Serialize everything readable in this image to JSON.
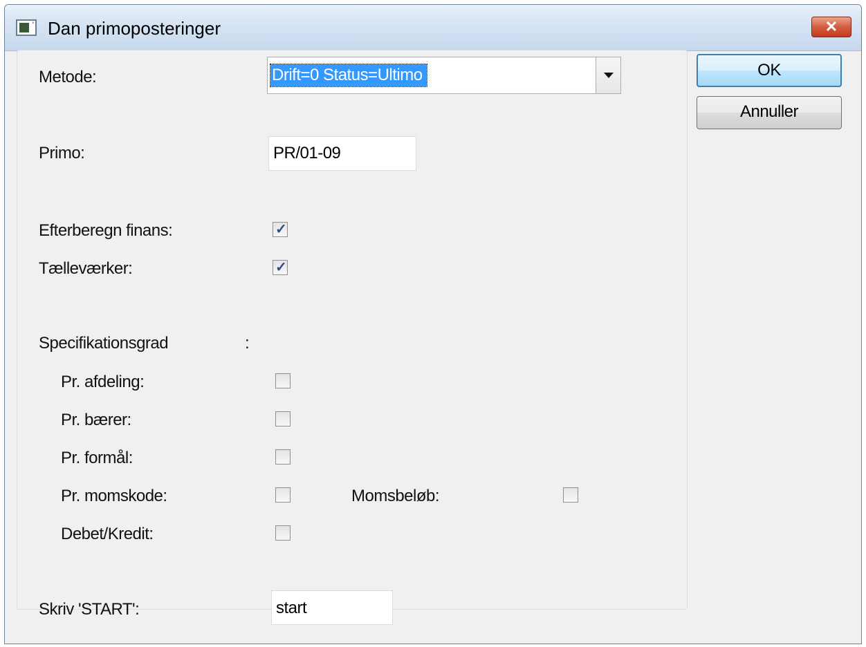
{
  "window": {
    "title": "Dan primoposteringer",
    "close_label": "✕"
  },
  "form": {
    "metode_label": "Metode:",
    "metode_value": "Drift=0 Status=Ultimo",
    "primo_label": "Primo:",
    "primo_value": "PR/01-09",
    "efterberegn_label": "Efterberegn finans:",
    "efterberegn_checked": true,
    "taellevaerker_label": "Tælleværker:",
    "taellevaerker_checked": true,
    "specifikationsgrad_label": "Specifikationsgrad",
    "specifikationsgrad_colon": ":",
    "afdeling_label": "Pr. afdeling:",
    "afdeling_checked": false,
    "baerer_label": "Pr. bærer:",
    "baerer_checked": false,
    "formaal_label": "Pr. formål:",
    "formaal_checked": false,
    "momskode_label": "Pr. momskode:",
    "momskode_checked": false,
    "momsbeloeb_label": "Momsbeløb:",
    "momsbeloeb_checked": false,
    "debetkredit_label": "Debet/Kredit:",
    "debetkredit_checked": false,
    "start_label": "Skriv 'START':",
    "start_value": "start"
  },
  "buttons": {
    "ok": "OK",
    "cancel": "Annuller"
  },
  "icons": {
    "check": "✓"
  }
}
